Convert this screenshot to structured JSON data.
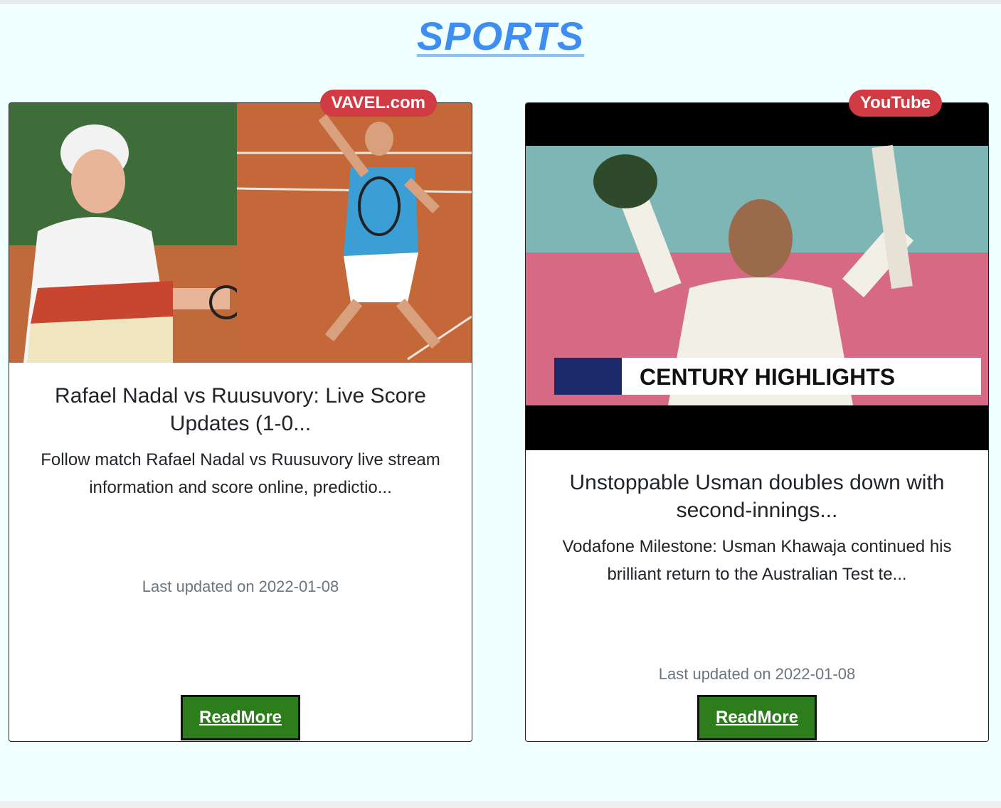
{
  "page": {
    "title": "SPORTS"
  },
  "cards": [
    {
      "source": "VAVEL.com",
      "image_desc_icon": "tennis-photo",
      "title": "Rafael Nadal vs Ruusuvory: Live Score Updates (1-0...",
      "description": "Follow match Rafael Nadal vs Ruusuvory live stream information and score online, predictio...",
      "updated": "Last updated on 2022-01-08",
      "button": "ReadMore"
    },
    {
      "source": "YouTube",
      "image_desc_icon": "cricket-photo",
      "image_caption": "CENTURY HIGHLIGHTS",
      "title": "Unstoppable Usman doubles down with second-innings...",
      "description": "Vodafone Milestone: Usman Khawaja continued his brilliant return to the Australian Test te...",
      "updated": "Last updated on 2022-01-08",
      "button": "ReadMore"
    }
  ],
  "colors": {
    "background": "#f0ffff",
    "title": "#3d8ef0",
    "badge": "#d13b44",
    "button": "#2e7d1c"
  }
}
